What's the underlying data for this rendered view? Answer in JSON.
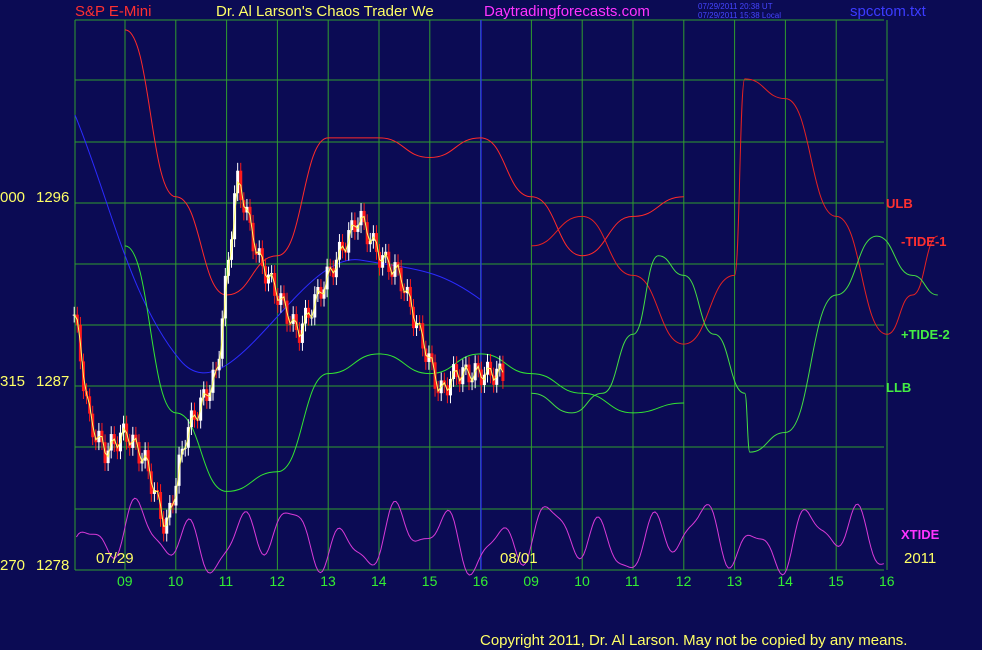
{
  "header": {
    "instrument": "S&P E-Mini",
    "title": "Dr. Al Larson's Chaos Trader We",
    "site": "Daytradingforecasts.com",
    "stamp_ut": "07/29/2011 20:38 UT",
    "stamp_local": "07/29/2011 15:38 Local",
    "filename": "spcctom.txt"
  },
  "footer": {
    "copyright": "Copyright 2011, Dr. Al Larson. May not be copied by any means."
  },
  "colors": {
    "background": "#0b0b54",
    "grid": "#2f9e2f",
    "price_up": "#ffffff",
    "price_down": "#ff1a1a",
    "ulb": "#ff2a2a",
    "llb": "#33e633",
    "tide_minus_1": "#e62222",
    "tide_plus_2": "#44dd44",
    "xtide": "#d83ad8",
    "blue_line": "#2b2bff",
    "yellow": "#ffff66"
  },
  "chart_data": {
    "type": "line",
    "title": "S&P E-Mini",
    "y_ticks": [
      {
        "left": "000",
        "value": "1296"
      },
      {
        "left": "315",
        "value": "1287"
      },
      {
        "left": "270",
        "value": "1278"
      }
    ],
    "ylim": [
      1278,
      1306
    ],
    "x_ticks": [
      "09",
      "10",
      "11",
      "12",
      "13",
      "14",
      "15",
      "16",
      "09",
      "10",
      "11",
      "12",
      "13",
      "14",
      "15",
      "16"
    ],
    "date_labels": [
      "07/29",
      "08/01"
    ],
    "year_label": "2011",
    "series": [
      {
        "name": "ULB",
        "x": [
          0,
          1,
          2,
          3,
          4,
          5,
          6,
          7,
          8,
          9,
          10,
          11
        ],
        "y": [
          1305.5,
          1297,
          1292,
          1294,
          1300,
          1300,
          1299,
          1300,
          1297,
          1294,
          1296,
          1297
        ]
      },
      {
        "name": "LLB",
        "x": [
          0,
          1,
          2,
          3,
          4,
          5,
          6,
          7,
          8,
          9,
          10,
          11
        ],
        "y": [
          1294.5,
          1286,
          1282,
          1283,
          1288,
          1289,
          1288,
          1289,
          1288,
          1287,
          1286,
          1286.5
        ]
      },
      {
        "name": "-TIDE-1",
        "x": [
          8,
          9,
          10,
          11,
          12,
          12.2,
          13,
          14,
          15,
          15.5,
          16
        ],
        "y": [
          1294.5,
          1296,
          1293,
          1289.5,
          1293,
          1303,
          1302,
          1296,
          1290,
          1292,
          1295
        ]
      },
      {
        "name": "+TIDE-2",
        "x": [
          8,
          8.8,
          9.4,
          10,
          10.5,
          11,
          11.6,
          12.2,
          12.3,
          13,
          14,
          14.8,
          15.5,
          16
        ],
        "y": [
          1287,
          1286,
          1287,
          1290,
          1294,
          1293,
          1290,
          1287,
          1284,
          1285,
          1292,
          1295,
          1293,
          1292
        ]
      },
      {
        "name": "XTIDE",
        "x": [
          0,
          16
        ],
        "y": [
          1279,
          1281
        ]
      },
      {
        "name": "Price",
        "x": [
          0,
          0.3,
          0.6,
          1,
          1.4,
          1.8,
          2.2,
          2.8,
          3.2,
          3.6,
          4,
          4.4,
          4.8,
          5.2,
          5.6,
          6,
          6.4,
          6.8,
          7.2,
          7.5
        ],
        "y": [
          1291,
          1285.5,
          1284,
          1285,
          1283.5,
          1280,
          1285,
          1288,
          1298,
          1294,
          1292,
          1290,
          1292,
          1294,
          1296,
          1294,
          1293,
          1290,
          1287,
          1288
        ]
      }
    ],
    "legend": [
      "ULB",
      "-TIDE-1",
      "+TIDE-2",
      "LLB",
      "XTIDE"
    ],
    "grid": true
  }
}
